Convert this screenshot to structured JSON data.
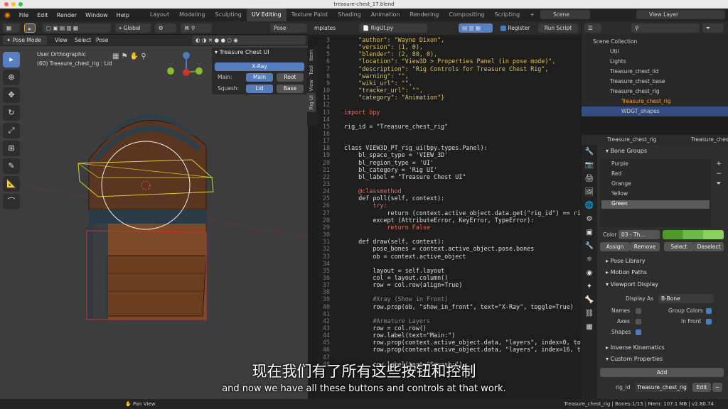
{
  "window": {
    "title": "treasure-chest_17.blend"
  },
  "menus": [
    "File",
    "Edit",
    "Render",
    "Window",
    "Help"
  ],
  "workspaces": [
    "Layout",
    "Modeling",
    "Sculpting",
    "UV Editing",
    "Texture Paint",
    "Shading",
    "Animation",
    "Rendering",
    "Compositing",
    "Scripting"
  ],
  "active_workspace": "UV Editing",
  "scene_label": "Scene",
  "view_layer_label": "View Layer",
  "viewport": {
    "orientation": "Global",
    "pose_options": "Pose Options",
    "mode": "Pose Mode",
    "menus": [
      "View",
      "Select",
      "Pose"
    ],
    "view_name": "User Orthographic",
    "object_info": "(60) Treasure_chest_rig : Lid"
  },
  "npanel": {
    "title": "Treasure Chest UI",
    "xray": "X-Ray",
    "main_label": "Main:",
    "main_btn": "Main",
    "root_btn": "Root",
    "squash_label": "Squash:",
    "lid_btn": "Lid",
    "base_btn": "Base",
    "tabs": [
      "Item",
      "Tool",
      "View",
      "Rig UI"
    ]
  },
  "editor": {
    "tab_templates": "mplates",
    "file": "RigUI.py",
    "register": "Register",
    "run": "Run Script",
    "lines": [
      {
        "n": "3",
        "t": "    \"author\": \"Wayne Dixon\",",
        "c": "s"
      },
      {
        "n": "4",
        "t": "    \"version\": (1, 0),",
        "c": "s"
      },
      {
        "n": "5",
        "t": "    \"blender\": (2, 80, 0),",
        "c": "s"
      },
      {
        "n": "6",
        "t": "    \"location\": \"View3D > Properties Panel (in pose mode)\",",
        "c": "s"
      },
      {
        "n": "7",
        "t": "    \"description\": \"Rig Controls for Treasure Chest Rig\",",
        "c": "s"
      },
      {
        "n": "8",
        "t": "    \"warning\": \"\",",
        "c": "s"
      },
      {
        "n": "9",
        "t": "    \"wiki_url\": \"\",",
        "c": "s"
      },
      {
        "n": "10",
        "t": "    \"tracker_url\": \"\",",
        "c": "s"
      },
      {
        "n": "11",
        "t": "    \"category\": \"Animation\"}",
        "c": "s"
      },
      {
        "n": "12",
        "t": "",
        "c": "n"
      },
      {
        "n": "13",
        "t": "import bpy",
        "c": "k"
      },
      {
        "n": "14",
        "t": "",
        "c": "n"
      },
      {
        "n": "15",
        "t": "rig_id = \"Treasure_chest_rig\"",
        "c": "n"
      },
      {
        "n": "16",
        "t": "",
        "c": "n"
      },
      {
        "n": "17",
        "t": "",
        "c": "n"
      },
      {
        "n": "18",
        "t": "class VIEW3D_PT_rig_ui(bpy.types.Panel):",
        "c": "n"
      },
      {
        "n": "19",
        "t": "    bl_space_type = 'VIEW_3D'",
        "c": "n"
      },
      {
        "n": "20",
        "t": "    bl_region_type = 'UI'",
        "c": "n"
      },
      {
        "n": "21",
        "t": "    bl_category = 'Rig UI'",
        "c": "n"
      },
      {
        "n": "22",
        "t": "    bl_label = \"Treasure Chest UI\"",
        "c": "n"
      },
      {
        "n": "23",
        "t": "",
        "c": "n"
      },
      {
        "n": "24",
        "t": "    @classmethod",
        "c": "k"
      },
      {
        "n": "25",
        "t": "    def poll(self, context):",
        "c": "n"
      },
      {
        "n": "26",
        "t": "        try:",
        "c": "k"
      },
      {
        "n": "27",
        "t": "            return (context.active_object.data.get(\"rig_id\") == rig_id)",
        "c": "n"
      },
      {
        "n": "28",
        "t": "        except (AttributeError, KeyError, TypeError):",
        "c": "n"
      },
      {
        "n": "29",
        "t": "            return False",
        "c": "k"
      },
      {
        "n": "30",
        "t": "",
        "c": "n"
      },
      {
        "n": "31",
        "t": "    def draw(self, context):",
        "c": "n"
      },
      {
        "n": "32",
        "t": "        pose_bones = context.active_object.pose.bones",
        "c": "n"
      },
      {
        "n": "33",
        "t": "        ob = context.active_object",
        "c": "n"
      },
      {
        "n": "34",
        "t": "",
        "c": "n"
      },
      {
        "n": "35",
        "t": "        layout = self.layout",
        "c": "n"
      },
      {
        "n": "36",
        "t": "        col = layout.column()",
        "c": "n"
      },
      {
        "n": "37",
        "t": "        row = col.row(align=True)",
        "c": "n"
      },
      {
        "n": "38",
        "t": "",
        "c": "n"
      },
      {
        "n": "39",
        "t": "        #Xray (Show in Front)",
        "c": "c"
      },
      {
        "n": "40",
        "t": "        row.prop(ob, \"show_in_front\", text=\"X-Ray\", toggle=True)",
        "c": "n"
      },
      {
        "n": "41",
        "t": "",
        "c": "n"
      },
      {
        "n": "42",
        "t": "        #Armature Layers",
        "c": "c"
      },
      {
        "n": "43",
        "t": "        row = col.row()",
        "c": "n"
      },
      {
        "n": "44",
        "t": "        row.label(text=\"Main:\")",
        "c": "n"
      },
      {
        "n": "45",
        "t": "        row.prop(context.active_object.data, \"layers\", index=0, toggle=1",
        "c": "n"
      },
      {
        "n": "46",
        "t": "        row.prop(context.active_object.data, \"layers\", index=16, toggle=",
        "c": "n"
      },
      {
        "n": "47",
        "t": "",
        "c": "n"
      },
      {
        "n": "48",
        "t": "        row.label(text=\"Squash:\")",
        "c": "n"
      }
    ]
  },
  "outliner": {
    "rows": [
      {
        "label": "Scene Collection"
      },
      {
        "label": "Util"
      },
      {
        "label": "Lights"
      },
      {
        "label": "Treasure_chest_lid"
      },
      {
        "label": "Treasure_chest_base"
      },
      {
        "label": "Treasure_chest_rig"
      },
      {
        "label": "Treasure_chest_rig"
      },
      {
        "label": "WDGT_shapes"
      }
    ]
  },
  "properties": {
    "obj1": "Treasure_chest_rig",
    "obj2": "Treasure_chest_rig",
    "bone_groups": "Bone Groups",
    "groups": [
      "Purple",
      "Red",
      "Orange",
      "Yellow",
      "Green"
    ],
    "color_label": "Color",
    "color_value": "03 - Th...",
    "assign": "Assign",
    "remove": "Remove",
    "select": "Select",
    "deselect": "Deselect",
    "pose_library": "Pose Library",
    "motion_paths": "Motion Paths",
    "viewport_display": "Viewport Display",
    "display_as_label": "Display As",
    "display_as": "B-Bone",
    "names": "Names",
    "axes": "Axes",
    "shapes": "Shapes",
    "group_colors": "Group Colors",
    "in_front": "In Front",
    "inverse_kinematics": "Inverse Kinematics",
    "custom_properties": "Custom Properties",
    "add": "Add",
    "prop_name": "rig_id",
    "prop_value": "Treasure_chest_rig",
    "edit": "Edit"
  },
  "status": {
    "left": "Pan View",
    "right": "Treasure_chest_rig | Bones:1/15 | Mem: 107.1 MB | v2.80.74"
  },
  "subtitles": {
    "zh": "现在我们有了所有这些按钮和控制",
    "en": "and now we have all these buttons and controls at that work."
  },
  "colors": {
    "accent": "#5680c2",
    "active_row": "#334d80",
    "highlight": "#f0a030"
  }
}
